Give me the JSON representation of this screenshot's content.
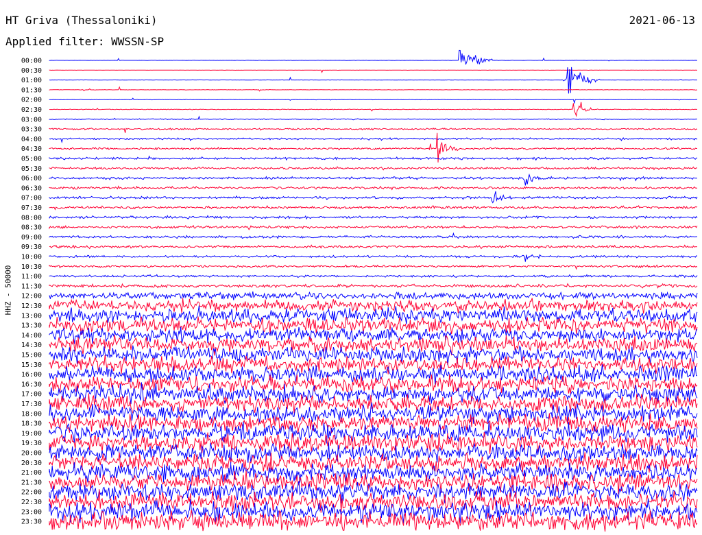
{
  "header": {
    "station": "HT Griva (Thessaloniki)",
    "filter": "Applied filter: WWSSN-SP",
    "date": "2021-06-13"
  },
  "side_label": "HHZ - 50000",
  "colors": {
    "odd_trace": "#0000ff",
    "even_trace": "#ff0033",
    "background": "#ffffff"
  },
  "chart_data": {
    "type": "line",
    "title": "HT Griva (Thessaloniki)",
    "subtitle": "Applied filter: WWSSN-SP",
    "ylabel": "HHZ - 50000",
    "xlabel": "",
    "row_labels": [
      "00:00",
      "00:30",
      "01:00",
      "01:30",
      "02:00",
      "02:30",
      "03:00",
      "03:30",
      "04:00",
      "04:30",
      "05:00",
      "05:30",
      "06:00",
      "06:30",
      "07:00",
      "07:30",
      "08:00",
      "08:30",
      "09:00",
      "09:30",
      "10:00",
      "10:30",
      "11:00",
      "11:30",
      "12:00",
      "12:30",
      "13:00",
      "13:30",
      "14:00",
      "14:30",
      "15:00",
      "15:30",
      "16:00",
      "16:30",
      "17:00",
      "17:30",
      "18:00",
      "18:30",
      "19:00",
      "19:30",
      "20:00",
      "20:30",
      "21:00",
      "21:30",
      "22:00",
      "22:30",
      "23:00",
      "23:30"
    ],
    "row_span_minutes": 30,
    "noise_level": [
      0.05,
      0.05,
      0.05,
      0.08,
      0.12,
      0.15,
      0.2,
      0.35,
      0.4,
      0.45,
      0.5,
      0.5,
      0.5,
      0.55,
      0.55,
      0.55,
      0.55,
      0.55,
      0.55,
      0.55,
      0.5,
      0.5,
      0.5,
      0.7,
      1.5,
      2.5,
      3,
      3.2,
      3.2,
      3.3,
      3.3,
      3.4,
      3.4,
      3.5,
      3.6,
      3.6,
      3.7,
      3.7,
      3.7,
      3.7,
      3.8,
      3.8,
      3.8,
      3.8,
      3.9,
      3.9,
      3.9,
      4.0
    ],
    "events": [
      {
        "row": 0,
        "minute": 19.0,
        "amplitude": 12,
        "duration_min": 1.5
      },
      {
        "row": 2,
        "minute": 24.0,
        "amplitude": 14,
        "duration_min": 1.5
      },
      {
        "row": 5,
        "minute": 24.3,
        "amplitude": 10,
        "duration_min": 0.8
      },
      {
        "row": 9,
        "minute": 18.0,
        "amplitude": 6,
        "duration_min": 1.0
      },
      {
        "row": 12,
        "minute": 22.0,
        "amplitude": 4,
        "duration_min": 1.0
      },
      {
        "row": 14,
        "minute": 20.5,
        "amplitude": 3,
        "duration_min": 1.0
      },
      {
        "row": 20,
        "minute": 22.0,
        "amplitude": 3,
        "duration_min": 1.0
      }
    ]
  }
}
